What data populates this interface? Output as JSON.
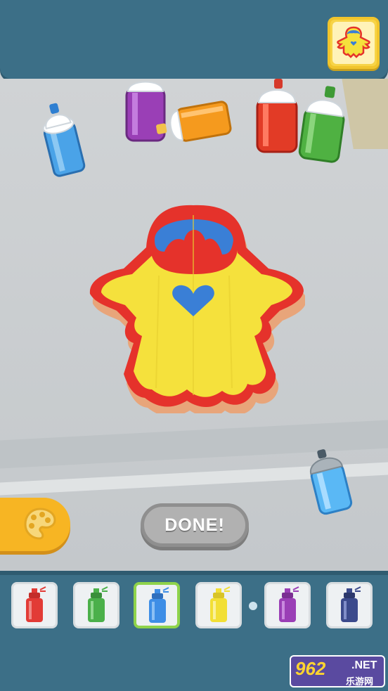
{
  "header": {
    "target_preview": "target-character-thumbnail"
  },
  "main": {
    "done_label": "DONE!",
    "palette_icon": "palette-icon",
    "character": {
      "body_color": "#f5e13c",
      "outline_color": "#e5322b",
      "hair_color": "#3a7fd6",
      "heart_color": "#3a7fd6",
      "wood_edge_color": "#e8a57a"
    }
  },
  "palette": {
    "colors": [
      {
        "name": "red",
        "hex": "#e23b36"
      },
      {
        "name": "green",
        "hex": "#4bb04a"
      },
      {
        "name": "blue",
        "hex": "#3e8ee6"
      },
      {
        "name": "yellow",
        "hex": "#f2df35"
      },
      {
        "name": "purple",
        "hex": "#9a3fb6"
      },
      {
        "name": "navy",
        "hex": "#3b4a8c"
      }
    ],
    "selected_index": 2
  },
  "watermark": {
    "main": "962",
    "net": ".NET",
    "sub": "乐游网"
  }
}
